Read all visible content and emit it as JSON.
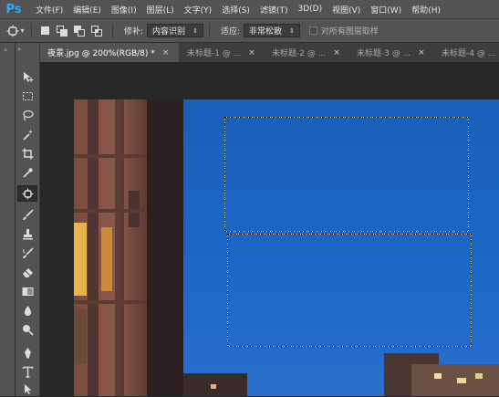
{
  "app": {
    "logo": "Ps"
  },
  "menu": [
    "文件(F)",
    "编辑(E)",
    "图像(I)",
    "图层(L)",
    "文字(Y)",
    "选择(S)",
    "滤镜(T)",
    "3D(D)",
    "视图(V)",
    "窗口(W)",
    "帮助(H)"
  ],
  "options": {
    "tool_icon": "spot-healing-brush-icon",
    "repair_label": "修补:",
    "repair_value": "内容识别",
    "adapt_label": "适应:",
    "adapt_value": "非常松散",
    "sample_all_label": "对所有图层取样",
    "sample_all_checked": false
  },
  "tabs": [
    {
      "label": "夜景.jpg @ 200%(RGB/8) *",
      "active": true
    },
    {
      "label": "未标题-1 @ ...",
      "active": false
    },
    {
      "label": "未标题-2 @ ...",
      "active": false
    },
    {
      "label": "未标题-3 @ ...",
      "active": false
    },
    {
      "label": "未标题-4 @ ...",
      "active": false
    }
  ],
  "toolbar_tools": [
    "move-icon",
    "rect-marquee-icon",
    "lasso-icon",
    "magic-wand-icon",
    "crop-icon",
    "eyedropper-icon",
    "patch-tool-icon",
    "brush-icon",
    "clone-stamp-icon",
    "history-brush-icon",
    "eraser-icon",
    "gradient-icon",
    "blur-icon",
    "dodge-icon",
    "pen-icon",
    "type-icon"
  ],
  "active_tool": "patch-tool-icon"
}
